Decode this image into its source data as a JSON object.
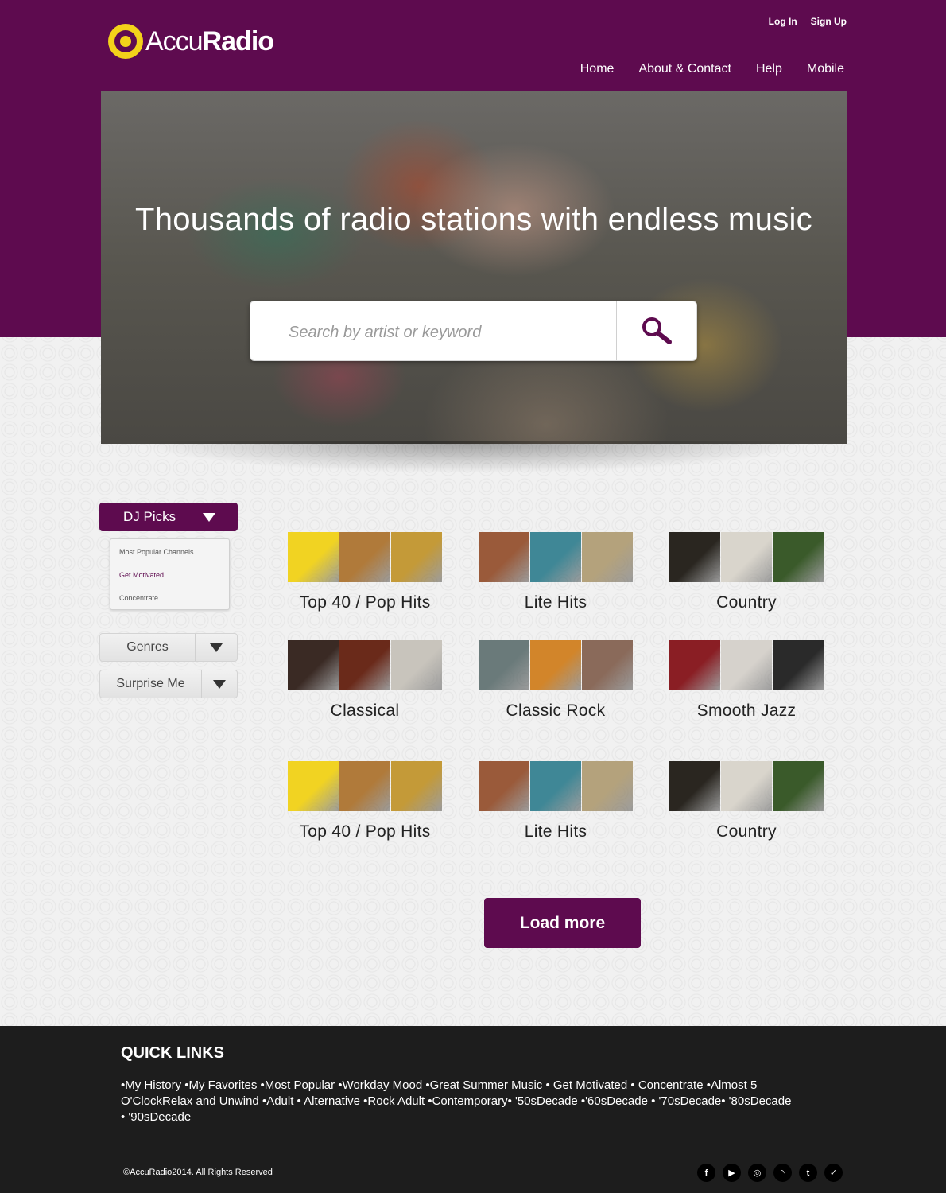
{
  "brand": {
    "name_light": "Accu",
    "name_bold": "Radio",
    "accent": "#5e0b4f",
    "logo_color": "#f3d21a"
  },
  "auth": {
    "login": "Log In",
    "signup": "Sign Up"
  },
  "nav": {
    "items": [
      "Home",
      "About & Contact",
      "Help",
      "Mobile"
    ]
  },
  "hero": {
    "title": "Thousands of radio stations with endless music",
    "search_placeholder": "Search by artist or keyword",
    "search_icon": "magnifier-icon"
  },
  "filters": {
    "dj_picks": {
      "label": "DJ Picks",
      "menu": [
        "Most Popular Channels",
        "Get Motivated",
        "Concentrate"
      ],
      "active": "Get Motivated"
    },
    "genres": "Genres",
    "surprise": "Surprise Me"
  },
  "channels": [
    {
      "name": "Top 40 / Pop Hits",
      "covers": [
        "#f1d322",
        "#b07a3a",
        "#c49a38"
      ]
    },
    {
      "name": "Lite Hits",
      "covers": [
        "#9a5a3a",
        "#3f8796",
        "#b4a27c"
      ]
    },
    {
      "name": "Country",
      "covers": [
        "#2a2620",
        "#d9d5cc",
        "#3a5a2a"
      ]
    },
    {
      "name": "Classical",
      "covers": [
        "#3a2a24",
        "#6a2a1a",
        "#c8c4bc"
      ]
    },
    {
      "name": "Classic Rock",
      "covers": [
        "#6a7a7a",
        "#d2852a",
        "#8a6a5a"
      ]
    },
    {
      "name": "Smooth Jazz",
      "covers": [
        "#8a1e24",
        "#d6d2cc",
        "#2a2a2a"
      ]
    },
    {
      "name": "Top 40 / Pop Hits",
      "covers": [
        "#f1d322",
        "#b07a3a",
        "#c49a38"
      ]
    },
    {
      "name": "Lite Hits",
      "covers": [
        "#9a5a3a",
        "#3f8796",
        "#b4a27c"
      ]
    },
    {
      "name": "Country",
      "covers": [
        "#2a2620",
        "#d9d5cc",
        "#3a5a2a"
      ]
    }
  ],
  "load_more": "Load more",
  "footer": {
    "quick_links_title": "QUICK LINKS",
    "quick_links_text": "•My History •My Favorites •Most Popular •Workday Mood •Great Summer Music • Get Motivated • Concentrate •Almost 5 O'ClockRelax and Unwind •Adult • Alternative •Rock Adult •Contemporary•  '50sDecade •'60sDecade • '70sDecade• '80sDecade • '90sDecade",
    "copyright": "©AccuRadio2014. All Rights Reserved",
    "socials": [
      {
        "icon": "facebook-icon",
        "glyph": "f"
      },
      {
        "icon": "youtube-icon",
        "glyph": "▶"
      },
      {
        "icon": "instagram-icon",
        "glyph": "◎"
      },
      {
        "icon": "rss-icon",
        "glyph": "◝"
      },
      {
        "icon": "tumblr-icon",
        "glyph": "t"
      },
      {
        "icon": "twitter-icon",
        "glyph": "✓"
      }
    ]
  }
}
